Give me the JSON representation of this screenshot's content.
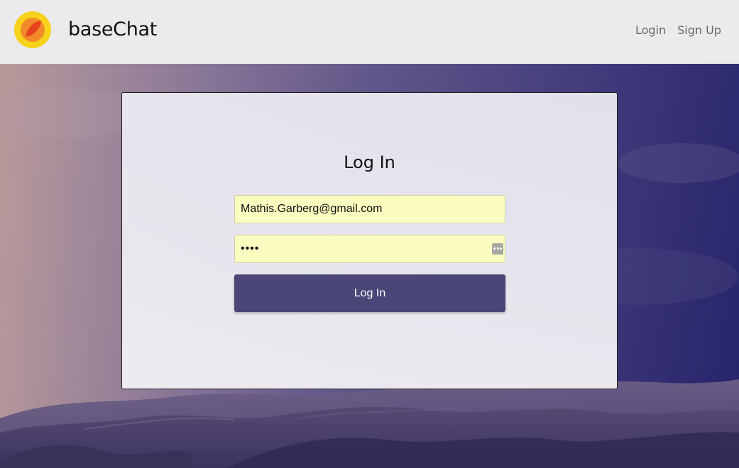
{
  "header": {
    "brand": "baseChat",
    "nav": {
      "login": "Login",
      "signup": "Sign Up"
    }
  },
  "login_form": {
    "title": "Log In",
    "email_value": "Mathis.Garberg@gmail.com",
    "password_value": "••••",
    "submit_label": "Log In"
  },
  "colors": {
    "header_bg": "#ebeaed",
    "button_bg": "#4a4677",
    "autofill_bg": "#fafcc0",
    "logo_outer": "#f7d21b",
    "logo_inner": "#f08a2b",
    "logo_leaf": "#e8431c"
  },
  "icons": {
    "logo": "logo-icon",
    "password_manager": "password-manager-icon"
  }
}
